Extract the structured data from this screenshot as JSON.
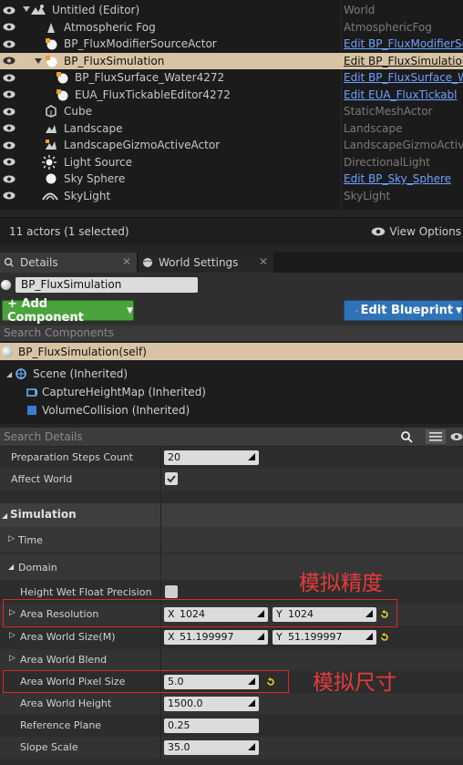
{
  "outliner": {
    "rows": [
      {
        "label": "Untitled (Editor)",
        "type": "World",
        "type_is_link": false
      },
      {
        "label": "Atmospheric Fog",
        "type": "AtmosphericFog",
        "type_is_link": false
      },
      {
        "label": "BP_FluxModifierSourceActor",
        "type": "Edit BP_FluxModifierSo",
        "type_is_link": true
      },
      {
        "label": "BP_FluxSimulation",
        "type": "Edit BP_FluxSimulation",
        "type_is_link": true
      },
      {
        "label": "BP_FluxSurface_Water4272",
        "type": "Edit BP_FluxSurface_W",
        "type_is_link": true
      },
      {
        "label": "EUA_FluxTickableEditor4272",
        "type": "Edit EUA_FluxTickabl",
        "type_is_link": true
      },
      {
        "label": "Cube",
        "type": "StaticMeshActor",
        "type_is_link": false
      },
      {
        "label": "Landscape",
        "type": "Landscape",
        "type_is_link": false
      },
      {
        "label": "LandscapeGizmoActiveActor",
        "type": "LandscapeGizmoActive",
        "type_is_link": false
      },
      {
        "label": "Light Source",
        "type": "DirectionalLight",
        "type_is_link": false
      },
      {
        "label": "Sky Sphere",
        "type": "Edit BP_Sky_Sphere",
        "type_is_link": true
      },
      {
        "label": "SkyLight",
        "type": "SkyLight",
        "type_is_link": false
      }
    ],
    "selected_row": "BP_FluxSimulation",
    "actor_count": "11 actors (1 selected)",
    "view_options": "View Options"
  },
  "tabs": [
    {
      "label": "Details",
      "active": true
    },
    {
      "label": "World Settings",
      "active": false
    }
  ],
  "details": {
    "actor_name": "BP_FluxSimulation",
    "add_component": "+ Add Component",
    "edit_blueprint": "Edit Blueprint",
    "search_components_placeholder": "Search Components",
    "self_row": "BP_FluxSimulation(self)",
    "components": [
      {
        "label": "Scene (Inherited)"
      },
      {
        "label": "CaptureHeightMap (Inherited)"
      },
      {
        "label": "VolumeCollision (Inherited)"
      }
    ],
    "search_details_placeholder": "Search Details"
  },
  "properties": {
    "preparation_steps": {
      "label": "Preparation Steps Count",
      "value": "20"
    },
    "affect_world": {
      "label": "Affect World",
      "checked": true
    },
    "simulation_category": "Simulation",
    "time_sub": "Time",
    "domain_sub": "Domain",
    "height_wet": {
      "label": "Height Wet Float Precision",
      "checked": false
    },
    "area_resolution": {
      "label": "Area Resolution",
      "x_axis": "X",
      "x": "1024",
      "y_axis": "Y",
      "y": "1024"
    },
    "area_world_size": {
      "label": "Area World Size(M)",
      "x_axis": "X",
      "x": "51.199997",
      "y_axis": "Y",
      "y": "51.199997"
    },
    "area_world_blend": {
      "label": "Area World Blend"
    },
    "area_world_pixel_size": {
      "label": "Area World Pixel Size",
      "value": "5.0"
    },
    "area_world_height": {
      "label": "Area World Height",
      "value": "1500.0"
    },
    "reference_plane": {
      "label": "Reference Plane",
      "value": "0.25"
    },
    "slope_scale": {
      "label": "Slope Scale",
      "value": "35.0"
    }
  },
  "annotations": {
    "precision": "模拟精度",
    "size": "模拟尺寸"
  },
  "colors": {
    "selection": "#d8c4a5",
    "link": "#6fa0ff",
    "add_component": "#4aa33c",
    "edit_blueprint": "#2f72b8",
    "annotation": "#e02828"
  }
}
